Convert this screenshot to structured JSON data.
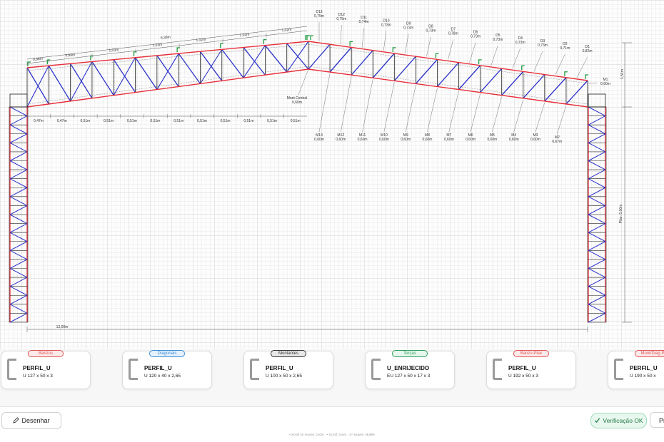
{
  "canvas": {
    "ridge_dims": [
      {
        "label": "D13",
        "value": "0,75m"
      },
      {
        "label": "D12",
        "value": "0,75m"
      },
      {
        "label": "D11",
        "value": "0,74m"
      },
      {
        "label": "D10",
        "value": "0,73m"
      },
      {
        "label": "D9",
        "value": "0,73m"
      },
      {
        "label": "D8",
        "value": "0,73m"
      },
      {
        "label": "D7",
        "value": "0,78m"
      },
      {
        "label": "D6",
        "value": "0,73m"
      },
      {
        "label": "D5",
        "value": "0,73m"
      },
      {
        "label": "D4",
        "value": "0,73m"
      },
      {
        "label": "D3",
        "value": "0,73m"
      },
      {
        "label": "D2",
        "value": "0,71m"
      },
      {
        "label": "D1",
        "value": "0,82m"
      }
    ],
    "m1": {
      "label": "M1",
      "value": "0,60m"
    },
    "bottom_dims": [
      {
        "label": "M13",
        "value": "0,60m"
      },
      {
        "label": "M12",
        "value": "0,60m"
      },
      {
        "label": "M11",
        "value": "0,60m"
      },
      {
        "label": "M10",
        "value": "0,60m"
      },
      {
        "label": "M9",
        "value": "0,60m"
      },
      {
        "label": "M8",
        "value": "0,60m"
      },
      {
        "label": "M7",
        "value": "0,60m"
      },
      {
        "label": "M6",
        "value": "0,60m"
      },
      {
        "label": "M5",
        "value": "0,60m"
      },
      {
        "label": "M4",
        "value": "0,60m"
      },
      {
        "label": "M3",
        "value": "0,60m"
      },
      {
        "label": "M2",
        "value": "0,67m"
      }
    ],
    "mont_central": {
      "label": "Mont Central",
      "value": "0,60m"
    },
    "slope_dims": [
      "0,88m",
      "0,99m",
      "1,03m",
      "1,03m",
      "1,02m",
      "1,02m",
      "1,02m"
    ],
    "total_slope": "6,38m",
    "spacing_dims": [
      "0,47m",
      "0,47m",
      "0,51m",
      "0,51m",
      "0,51m",
      "0,51m",
      "0,51m",
      "0,51m",
      "0,51m",
      "0,51m",
      "0,51m",
      "0,51m"
    ],
    "span": "13,00m",
    "right_height": "1,51m",
    "pilar_height": "Pilar: 5,00m"
  },
  "cards": [
    {
      "badge": "Banzos",
      "title": "PERFIL_U",
      "spec": "U 127 x 50 x 3",
      "color": "#e05656",
      "bg": "#fdeaea"
    },
    {
      "badge": "Diagonais",
      "title": "PERFIL_U",
      "spec": "U 120 x 40 x 2,65",
      "color": "#3a8ed8",
      "bg": "#e6f1fc"
    },
    {
      "badge": "Montantes",
      "title": "PERFIL_U",
      "spec": "U 100 x 50 x 2,65",
      "color": "#333333",
      "bg": "#e8e8e8"
    },
    {
      "badge": "Terças",
      "title": "U_ENRIJECIDO",
      "spec": "EU 127 x 50 x 17 x 3",
      "color": "#2f9e5b",
      "bg": "#e7f7ee"
    },
    {
      "badge": "Banzo Pilar",
      "title": "PERFIL_U",
      "spec": "U 192 x 50 x 3",
      "color": "#e05656",
      "bg": "#fdeaea"
    },
    {
      "badge": "Mont/Diag P",
      "title": "PERFIL_U",
      "spec": "U 190 x 50 x",
      "color": "#e05656",
      "bg": "#fdeaea"
    }
  ],
  "toolbar": {
    "draw_label": "Desenhar",
    "verify_label": "Verificação OK",
    "next_label": "Pr"
  },
  "hint": "• Scroll no mouse: zoom · • Scroll: zoom · 2+ toques: Mobile",
  "colors": {
    "chord": "#e8303a",
    "diagonal": "#2c33c9",
    "purlin": "#1f9d3f"
  }
}
